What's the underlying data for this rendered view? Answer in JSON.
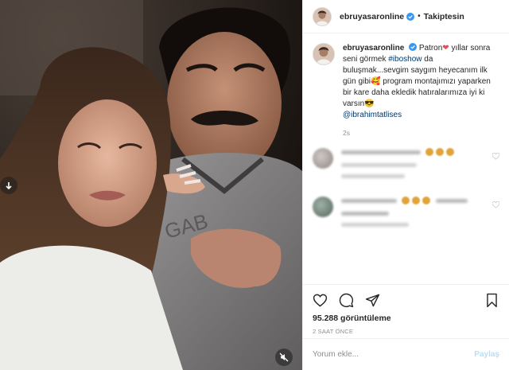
{
  "header": {
    "username": "ebruyasaronline",
    "separator": "•",
    "follow_state": "Takiptesin",
    "verified_icon": "verified-badge-icon"
  },
  "caption": {
    "username": "ebruyasaronline",
    "part1": "Patron",
    "part2": " yıllar sonra seni görmek ",
    "hashtag": "#iboshow",
    "part3": " da buluşmak...sevgim saygım heyecanım ilk gün gibi",
    "part4": " program montajımızı yaparken bir kare daha ekledik hatıralarımıza iyi ki varsın",
    "mention": "@ibrahimtatlises",
    "time": "2s"
  },
  "actions": {
    "like_icon": "heart-icon",
    "comment_icon": "comment-icon",
    "share_icon": "paper-plane-icon",
    "save_icon": "bookmark-icon",
    "views": "95.288 görüntüleme",
    "time_ago": "2 SAAT ÖNCE"
  },
  "comment_box": {
    "placeholder": "Yorum ekle...",
    "submit_label": "Paylaş"
  },
  "colors": {
    "link": "#00376b",
    "heart": "#ed4956",
    "submit_disabled": "#b2dffc",
    "muted": "#8e8e8e"
  }
}
